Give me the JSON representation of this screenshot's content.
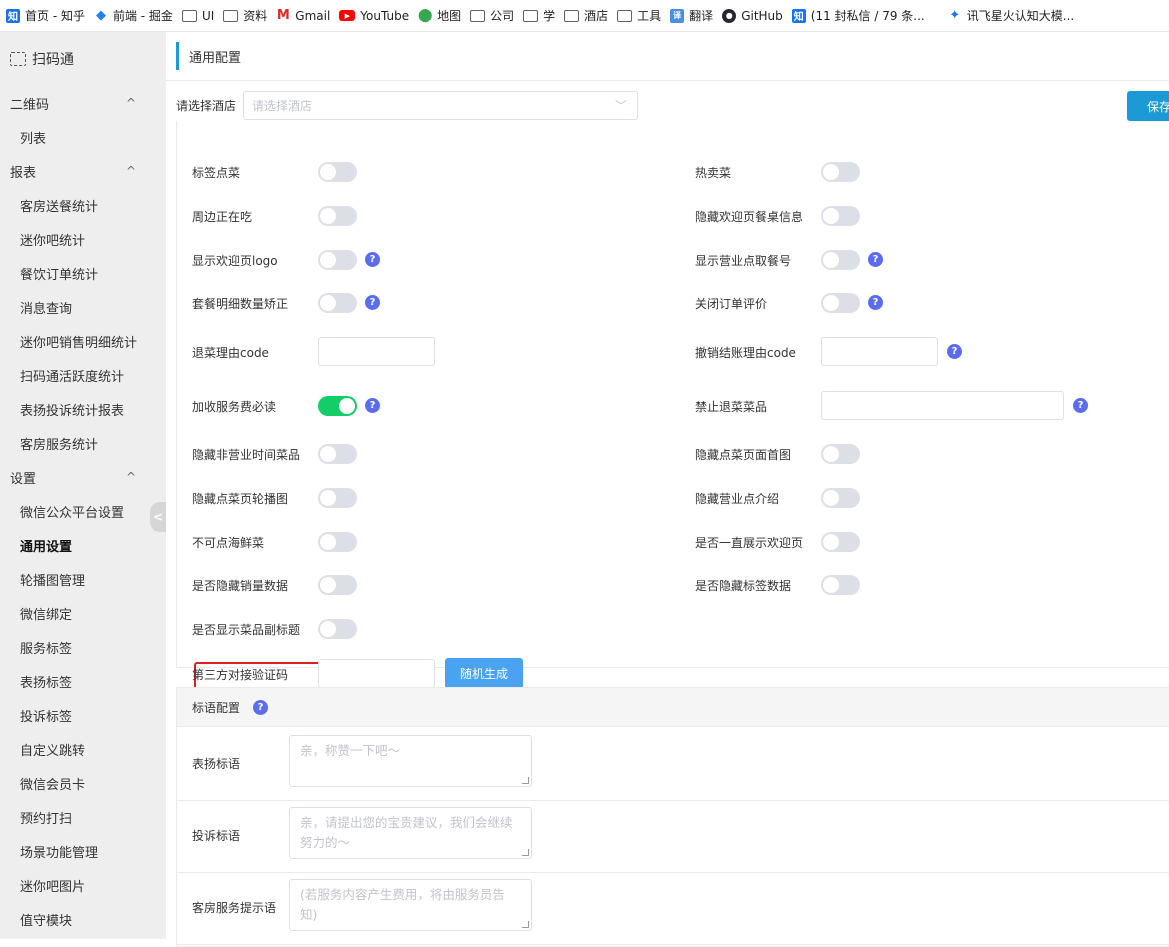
{
  "bookmarks": [
    {
      "label": "首页 - 知乎",
      "icon": "zhihu-icon",
      "glyph": "知"
    },
    {
      "label": "前端 - 掘金",
      "icon": "juejin-icon",
      "glyph": "◆"
    },
    {
      "label": "UI",
      "icon": "folder-icon",
      "glyph": ""
    },
    {
      "label": "资料",
      "icon": "folder-icon",
      "glyph": ""
    },
    {
      "label": "Gmail",
      "icon": "gmail-icon",
      "glyph": "M"
    },
    {
      "label": "YouTube",
      "icon": "youtube-icon",
      "glyph": "▶"
    },
    {
      "label": "地图",
      "icon": "map-pin-icon",
      "glyph": "⬤"
    },
    {
      "label": "公司",
      "icon": "folder-icon",
      "glyph": ""
    },
    {
      "label": "学",
      "icon": "folder-icon",
      "glyph": ""
    },
    {
      "label": "酒店",
      "icon": "folder-icon",
      "glyph": ""
    },
    {
      "label": "工具",
      "icon": "folder-icon",
      "glyph": ""
    },
    {
      "label": "翻译",
      "icon": "translate-icon",
      "glyph": "译"
    },
    {
      "label": "GitHub",
      "icon": "github-icon",
      "glyph": "●"
    },
    {
      "label": "(11 封私信 / 79 条...",
      "icon": "zhihu-icon",
      "glyph": "知"
    },
    {
      "label": "讯飞星火认知大模...",
      "icon": "xinghuo-icon",
      "glyph": "✦"
    }
  ],
  "sidebar": {
    "brand": "扫码通",
    "groups": [
      {
        "label": "二维码",
        "items": [
          "列表"
        ]
      },
      {
        "label": "报表",
        "items": [
          "客房送餐统计",
          "迷你吧统计",
          "餐饮订单统计",
          "消息查询",
          "迷你吧销售明细统计",
          "扫码通活跃度统计",
          "表扬投诉统计报表",
          "客房服务统计"
        ]
      },
      {
        "label": "设置",
        "items": [
          "微信公众平台设置",
          "通用设置",
          "轮播图管理",
          "微信绑定",
          "服务标签",
          "表扬标签",
          "投诉标签",
          "自定义跳转",
          "微信会员卡",
          "预约打扫",
          "场景功能管理",
          "迷你吧图片",
          "值守模块"
        ]
      }
    ],
    "active_item": "通用设置",
    "group_chevron": "^",
    "collapse_glyph": "<"
  },
  "header": {
    "title": "通用配置"
  },
  "hotel": {
    "label": "请选择酒店",
    "placeholder": "请选择酒店",
    "arrow": "﹀"
  },
  "save_label": "保存",
  "help_glyph": "?",
  "settings_left": [
    {
      "label": "标签点菜",
      "type": "switch",
      "on": false,
      "help": false
    },
    {
      "label": "周边正在吃",
      "type": "switch",
      "on": false,
      "help": false
    },
    {
      "label": "显示欢迎页logo",
      "type": "switch",
      "on": false,
      "help": true
    },
    {
      "label": "套餐明细数量矫正",
      "type": "switch",
      "on": false,
      "help": true
    },
    {
      "label": "退菜理由code",
      "type": "input",
      "value": "",
      "help": false
    },
    {
      "label": "加收服务费必读",
      "type": "switch",
      "on": true,
      "help": true
    },
    {
      "label": "隐藏非营业时间菜品",
      "type": "switch",
      "on": false,
      "help": false
    },
    {
      "label": "隐藏点菜页轮播图",
      "type": "switch",
      "on": false,
      "help": false
    },
    {
      "label": "不可点海鲜菜",
      "type": "switch",
      "on": false,
      "help": false
    },
    {
      "label": "是否隐藏销量数据",
      "type": "switch",
      "on": false,
      "help": false
    },
    {
      "label": "是否显示菜品副标题",
      "type": "switch",
      "on": false,
      "help": false
    },
    {
      "label": "第三方对接验证码",
      "type": "input",
      "value": "",
      "help": false
    }
  ],
  "settings_right": [
    {
      "label": "热卖菜",
      "type": "switch",
      "on": false,
      "help": false
    },
    {
      "label": "隐藏欢迎页餐桌信息",
      "type": "switch",
      "on": false,
      "help": false
    },
    {
      "label": "显示营业点取餐号",
      "type": "switch",
      "on": false,
      "help": true
    },
    {
      "label": "关闭订单评价",
      "type": "switch",
      "on": false,
      "help": true
    },
    {
      "label": "撤销结账理由code",
      "type": "input",
      "value": "",
      "help": true
    },
    {
      "label": "禁止退菜菜品",
      "type": "input",
      "value": "",
      "help": true
    },
    {
      "label": "隐藏点菜页面首图",
      "type": "switch",
      "on": false,
      "help": false
    },
    {
      "label": "隐藏营业点介绍",
      "type": "switch",
      "on": false,
      "help": false
    },
    {
      "label": "是否一直展示欢迎页",
      "type": "switch",
      "on": false,
      "help": false
    },
    {
      "label": "是否隐藏标签数据",
      "type": "switch",
      "on": false,
      "help": false
    }
  ],
  "generate_label": "随机生成",
  "slogan": {
    "title": "标语配置",
    "rows": [
      {
        "label": "表扬标语",
        "placeholder": "亲，称赞一下吧～"
      },
      {
        "label": "投诉标语",
        "placeholder": "亲，请提出您的宝贵建议，我们会继续努力的～"
      },
      {
        "label": "客房服务提示语",
        "placeholder": "(若服务内容产生费用，将由服务员告知)"
      }
    ]
  },
  "colors": {
    "accent": "#1b9ad6",
    "switch_on": "#13ce66",
    "help": "#5b6cf0",
    "highlight": "#e02020"
  }
}
